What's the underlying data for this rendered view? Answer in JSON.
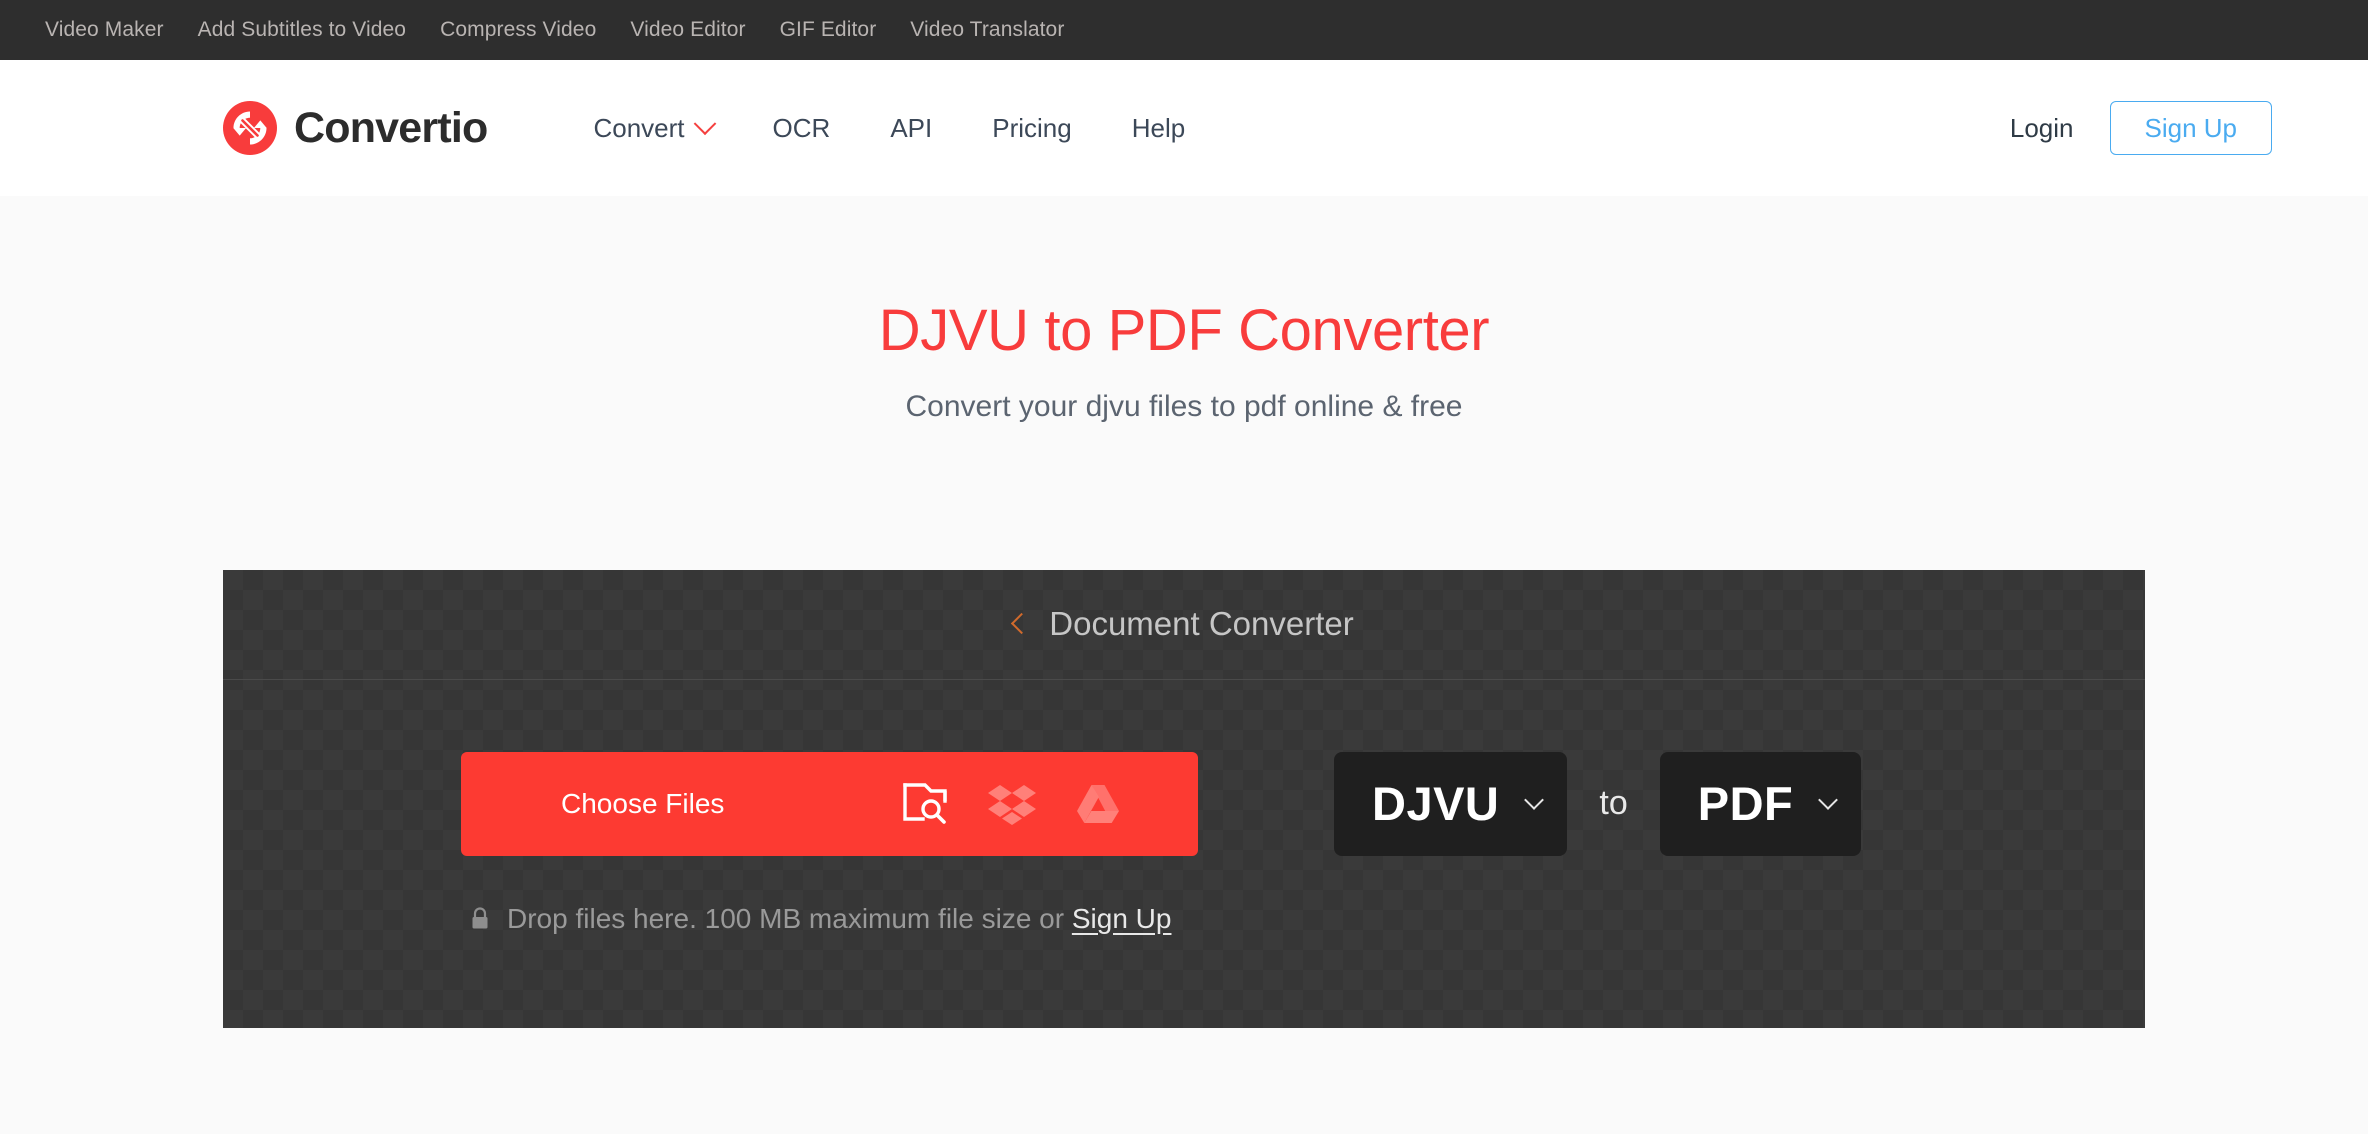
{
  "topbar": {
    "links": [
      {
        "label": "Video Maker"
      },
      {
        "label": "Add Subtitles to Video"
      },
      {
        "label": "Compress Video"
      },
      {
        "label": "Video Editor"
      },
      {
        "label": "GIF Editor"
      },
      {
        "label": "Video Translator"
      }
    ]
  },
  "header": {
    "brand": "Convertio",
    "logo_icon": "convertio-logo-icon",
    "nav": [
      {
        "label": "Convert",
        "has_dropdown": true
      },
      {
        "label": "OCR",
        "has_dropdown": false
      },
      {
        "label": "API",
        "has_dropdown": false
      },
      {
        "label": "Pricing",
        "has_dropdown": false
      },
      {
        "label": "Help",
        "has_dropdown": false
      }
    ],
    "login_label": "Login",
    "signup_label": "Sign Up"
  },
  "hero": {
    "title": "DJVU to PDF Converter",
    "subtitle": "Convert your djvu files to pdf online & free"
  },
  "converter": {
    "panel_title": "Document Converter",
    "back_icon": "chevron-left-icon",
    "choose_files_label": "Choose Files",
    "sources": [
      {
        "name": "file-browse-icon"
      },
      {
        "name": "dropbox-icon"
      },
      {
        "name": "google-drive-icon"
      }
    ],
    "drop_lock_icon": "lock-icon",
    "drop_text_before": "Drop files here. 100 MB maximum file size or ",
    "drop_signup_label": "Sign Up",
    "source_format": "DJVU",
    "target_format": "PDF",
    "to_label": "to"
  },
  "colors": {
    "brand_red": "#fd3a32",
    "title_red": "#f83c3c",
    "accent_blue": "#4aabf0",
    "panel_dark": "#3a3a3a",
    "format_box": "#1f1f1f",
    "topbar_dark": "#2e2e2e"
  }
}
